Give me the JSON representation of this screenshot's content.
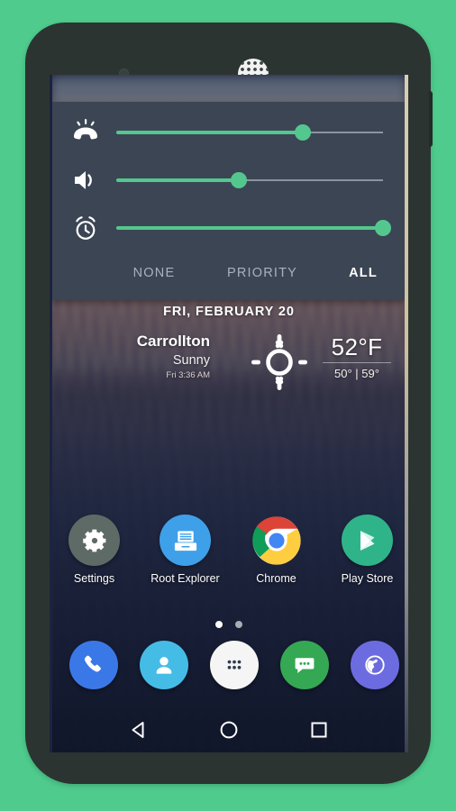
{
  "device": {
    "frame_color": "#2B3430",
    "background_color": "#4ECB8D",
    "earpiece": "speaker-grill",
    "sensor": "proximity-sensor"
  },
  "volume_panel": {
    "background_color": "#3B4554",
    "accent_color": "#54C78E",
    "sliders": [
      {
        "name": "ringtone",
        "icon": "ringer-volume-icon",
        "value": 70
      },
      {
        "name": "media",
        "icon": "speaker-volume-icon",
        "value": 46
      },
      {
        "name": "alarm",
        "icon": "alarm-clock-icon",
        "value": 100
      }
    ],
    "zen_modes": [
      {
        "label": "NONE",
        "selected": false
      },
      {
        "label": "PRIORITY",
        "selected": false
      },
      {
        "label": "ALL",
        "selected": true
      }
    ]
  },
  "weather_widget": {
    "date": "FRI, FEBRUARY 20",
    "city": "Carrollton",
    "condition": "Sunny",
    "updated": "Fri 3:36 AM",
    "icon": "sunny-icon",
    "temperature": "52°F",
    "high_low": "50° | 59°"
  },
  "apps": [
    {
      "label": "Settings",
      "icon": "gear-icon",
      "color": "#5D6A66"
    },
    {
      "label": "Root Explorer",
      "icon": "file-drawer-icon",
      "color": "#3EA0E8"
    },
    {
      "label": "Chrome",
      "icon": "chrome-icon",
      "color": "#DD4B37"
    },
    {
      "label": "Play Store",
      "icon": "play-store-icon",
      "color": "#2FB48A"
    }
  ],
  "page_indicator": {
    "count": 2,
    "active_index": 0
  },
  "dock": [
    {
      "label": "Phone",
      "icon": "phone-icon",
      "color": "#3B78E7"
    },
    {
      "label": "Contacts",
      "icon": "person-icon",
      "color": "#45BCE6"
    },
    {
      "label": "Apps",
      "icon": "app-drawer-icon",
      "color": "#F5F5F5"
    },
    {
      "label": "Messaging",
      "icon": "message-icon",
      "color": "#35A853"
    },
    {
      "label": "Browser",
      "icon": "globe-icon",
      "color": "#6C6CE0"
    }
  ],
  "navbar": [
    {
      "label": "Back",
      "icon": "back-triangle-icon"
    },
    {
      "label": "Home",
      "icon": "home-circle-icon"
    },
    {
      "label": "Recents",
      "icon": "recents-square-icon"
    }
  ]
}
